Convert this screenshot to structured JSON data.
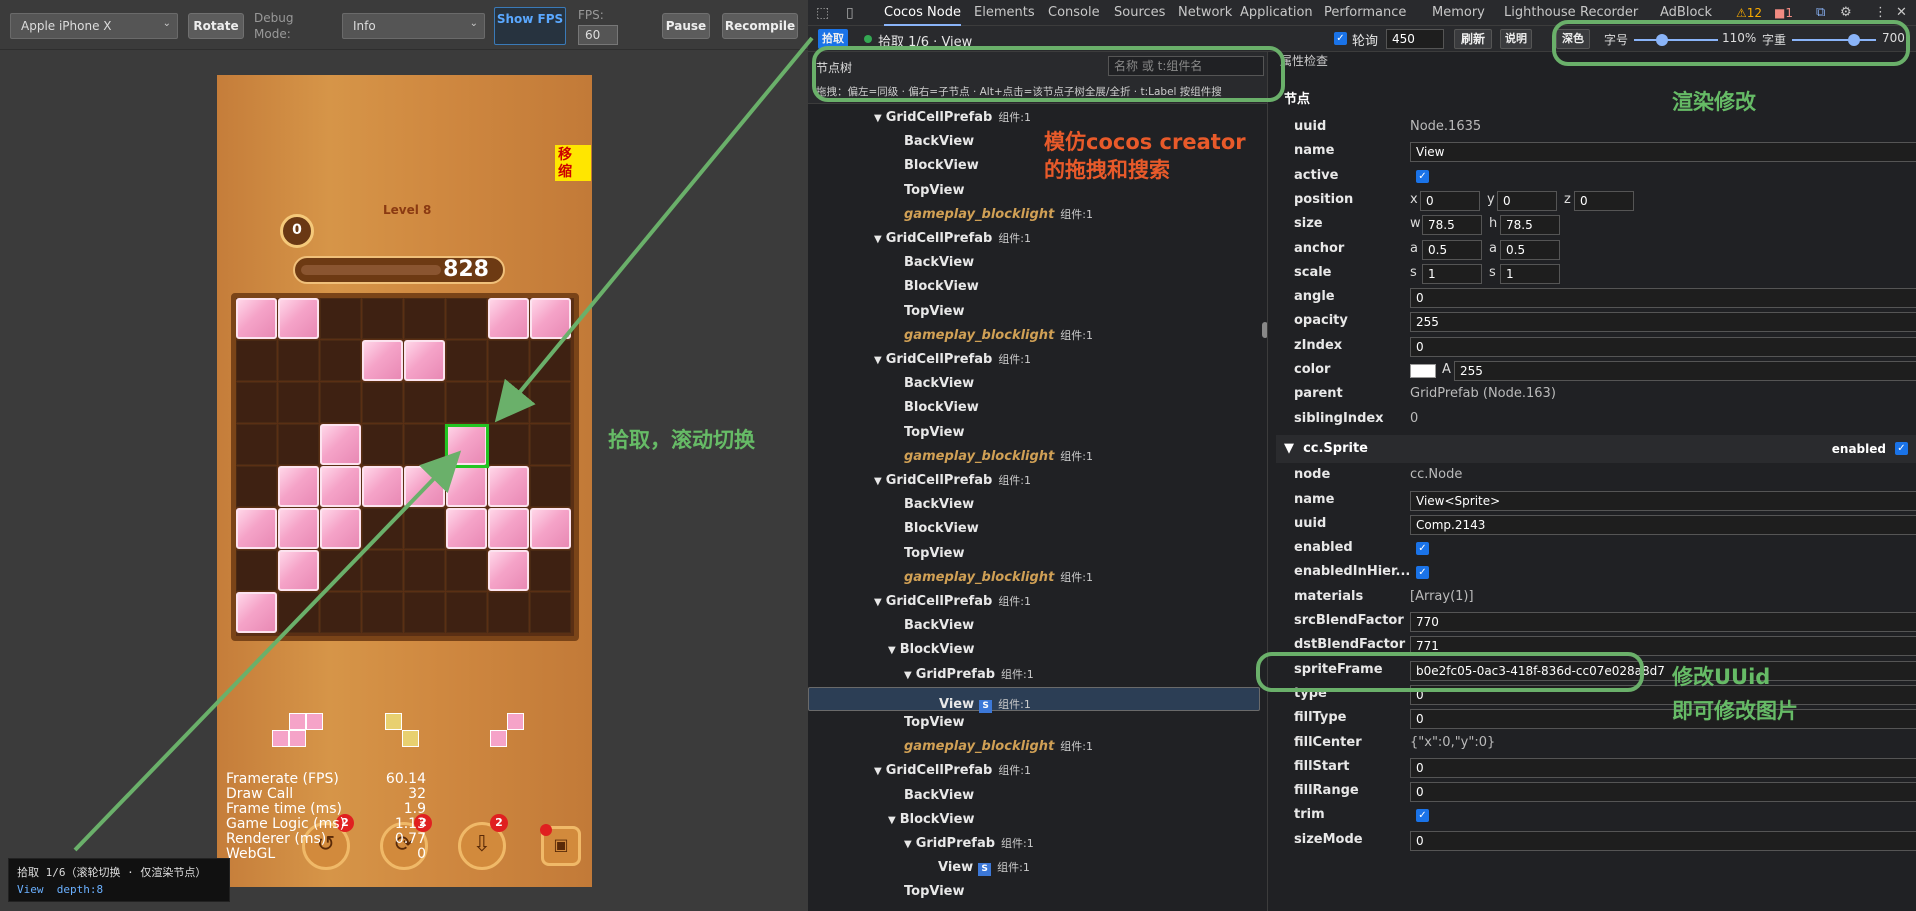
{
  "toolbar": {
    "device": "Apple iPhone X",
    "rotate": "Rotate",
    "debug_mode_label": "Debug Mode:",
    "debug_mode": "Info",
    "show_fps": "Show FPS",
    "fps_label": "FPS:",
    "fps_value": "60",
    "pause": "Pause",
    "recompile": "Recompile"
  },
  "game": {
    "level": "Level 8",
    "coins": "0",
    "score": "828",
    "badge_label": "移 缩",
    "stats": [
      [
        "Framerate (FPS)",
        "60.14"
      ],
      [
        "Draw Call",
        "32"
      ],
      [
        "Frame time (ms)",
        "1.9"
      ],
      [
        "Game Logic (ms)",
        "1.13"
      ],
      [
        "Renderer (ms)",
        "0.77"
      ],
      [
        "WebGL",
        "0"
      ]
    ],
    "btn_badges": [
      "2",
      "2",
      "2"
    ],
    "board": [
      [
        1,
        1,
        0,
        0,
        0,
        0,
        1,
        1
      ],
      [
        0,
        0,
        0,
        1,
        1,
        0,
        0,
        0
      ],
      [
        0,
        0,
        0,
        0,
        0,
        0,
        0,
        0
      ],
      [
        0,
        0,
        1,
        0,
        0,
        1,
        0,
        0
      ],
      [
        0,
        1,
        1,
        1,
        1,
        1,
        1,
        0
      ],
      [
        1,
        1,
        1,
        0,
        0,
        1,
        1,
        1
      ],
      [
        0,
        1,
        0,
        0,
        0,
        0,
        1,
        0
      ],
      [
        1,
        0,
        0,
        0,
        0,
        0,
        0,
        0
      ]
    ]
  },
  "tooltip": {
    "line1": "拾取 1/6（滚轮切换 · 仅渲染节点）",
    "line2_name": "View",
    "line2_depth": "depth:8"
  },
  "annotations": {
    "mimic": "模仿cocos creator\n的拖拽和搜索",
    "pick": "拾取，滚动切换",
    "render": "渲染修改",
    "uuid": "修改UUid\n即可修改图片"
  },
  "devtools": {
    "tabs": [
      "Cocos Node",
      "Elements",
      "Console",
      "Sources",
      "Network",
      "Application",
      "Performance",
      "Memory",
      "Lighthouse",
      "Recorder",
      "AdBlock"
    ],
    "warn_count": "12",
    "err_count": "1",
    "pick_btn": "拾取",
    "pick_status": "拾取 1/6 · View",
    "outline_label": "轮询",
    "outline_value": "450",
    "refresh": "刷新",
    "explain": "说明",
    "theme": "深色",
    "font_label": "字号",
    "font_value": "110%",
    "spacing_label": "字重",
    "spacing_value": "700",
    "tree_title": "节点树",
    "search_placeholder": "名称 或 t:组件名",
    "tree_hint": "拖拽：偏左=同级 · 偏右=子节点 · Alt+点击=该节点子树全展/全折 · t:Label 按组件搜",
    "props_title": "属性检查"
  },
  "tree": [
    {
      "name": "GridCellPrefab",
      "cnt": "组件:1",
      "d": 0,
      "arrow": true,
      "t": "n"
    },
    {
      "name": "BackView",
      "d": 1,
      "t": "n"
    },
    {
      "name": "BlockView",
      "d": 1,
      "t": "n"
    },
    {
      "name": "TopView",
      "d": 1,
      "t": "n"
    },
    {
      "name": "gameplay_blocklight",
      "cnt": "组件:1",
      "d": 1,
      "t": "o"
    },
    {
      "name": "GridCellPrefab",
      "cnt": "组件:1",
      "d": 0,
      "arrow": true,
      "t": "n"
    },
    {
      "name": "BackView",
      "d": 1,
      "t": "n"
    },
    {
      "name": "BlockView",
      "d": 1,
      "t": "n"
    },
    {
      "name": "TopView",
      "d": 1,
      "t": "n"
    },
    {
      "name": "gameplay_blocklight",
      "cnt": "组件:1",
      "d": 1,
      "t": "o"
    },
    {
      "name": "GridCellPrefab",
      "cnt": "组件:1",
      "d": 0,
      "arrow": true,
      "t": "n"
    },
    {
      "name": "BackView",
      "d": 1,
      "t": "n"
    },
    {
      "name": "BlockView",
      "d": 1,
      "t": "n"
    },
    {
      "name": "TopView",
      "d": 1,
      "t": "n"
    },
    {
      "name": "gameplay_blocklight",
      "cnt": "组件:1",
      "d": 1,
      "t": "o"
    },
    {
      "name": "GridCellPrefab",
      "cnt": "组件:1",
      "d": 0,
      "arrow": true,
      "t": "n"
    },
    {
      "name": "BackView",
      "d": 1,
      "t": "n"
    },
    {
      "name": "BlockView",
      "d": 1,
      "t": "n"
    },
    {
      "name": "TopView",
      "d": 1,
      "t": "n"
    },
    {
      "name": "gameplay_blocklight",
      "cnt": "组件:1",
      "d": 1,
      "t": "o"
    },
    {
      "name": "GridCellPrefab",
      "cnt": "组件:1",
      "d": 0,
      "arrow": true,
      "t": "n"
    },
    {
      "name": "BackView",
      "d": 1,
      "t": "n"
    },
    {
      "name": "BlockView",
      "d": 0.5,
      "arrow": true,
      "t": "n"
    },
    {
      "name": "GridPrefab",
      "cnt": "组件:1",
      "d": 1,
      "arrow": true,
      "t": "n"
    },
    {
      "name": "View",
      "cnt": "组件:1",
      "d": 2,
      "t": "s",
      "sel": true
    },
    {
      "name": "TopView",
      "d": 1,
      "t": "n"
    },
    {
      "name": "gameplay_blocklight",
      "cnt": "组件:1",
      "d": 1,
      "t": "o"
    },
    {
      "name": "GridCellPrefab",
      "cnt": "组件:1",
      "d": 0,
      "arrow": true,
      "t": "n"
    },
    {
      "name": "BackView",
      "d": 1,
      "t": "n"
    },
    {
      "name": "BlockView",
      "d": 0.5,
      "arrow": true,
      "t": "n"
    },
    {
      "name": "GridPrefab",
      "cnt": "组件:1",
      "d": 1,
      "arrow": true,
      "t": "n"
    },
    {
      "name": "View",
      "cnt": "组件:1",
      "d": 2,
      "t": "s"
    },
    {
      "name": "TopView",
      "d": 1,
      "t": "n"
    }
  ],
  "node": {
    "section": "节点",
    "uuid": "Node.1635",
    "name": "View",
    "pos": [
      "0",
      "0",
      "0"
    ],
    "size": [
      "78.5",
      "78.5"
    ],
    "anchor": [
      "0.5",
      "0.5"
    ],
    "scale": [
      "1",
      "1"
    ],
    "angle": "0",
    "opacity": "255",
    "zIndex": "0",
    "color_a": "255",
    "parent": "GridPrefab (Node.163)",
    "siblingIndex": "0"
  },
  "sprite": {
    "section": "cc.Sprite",
    "enabled_label": "enabled",
    "node": "cc.Node",
    "name": "View<Sprite>",
    "uuid": "Comp.2143",
    "materials": "[Array(1)]",
    "srcBlendFactor": "770",
    "dstBlendFactor": "771",
    "spriteFrame": "b0e2fc05-0ac3-418f-836d-cc07e028a8d7",
    "type": "0",
    "fillType": "0",
    "fillCenter": "{\"x\":0,\"y\":0}",
    "fillStart": "0",
    "fillRange": "0",
    "sizeMode": "0"
  },
  "labels": {
    "uuid": "uuid",
    "name": "name",
    "active": "active",
    "position": "position",
    "size": "size",
    "anchor": "anchor",
    "scale": "scale",
    "angle": "angle",
    "opacity": "opacity",
    "zIndex": "zIndex",
    "color": "color",
    "parent": "parent",
    "siblingIndex": "siblingIndex",
    "node": "node",
    "enabled": "enabled",
    "enabledInHier": "enabledInHier...",
    "materials": "materials",
    "srcBlendFactor": "srcBlendFactor",
    "dstBlendFactor": "dstBlendFactor",
    "spriteFrame": "spriteFrame",
    "type": "type",
    "fillType": "fillType",
    "fillCenter": "fillCenter",
    "fillStart": "fillStart",
    "fillRange": "fillRange",
    "trim": "trim",
    "sizeMode": "sizeMode"
  }
}
